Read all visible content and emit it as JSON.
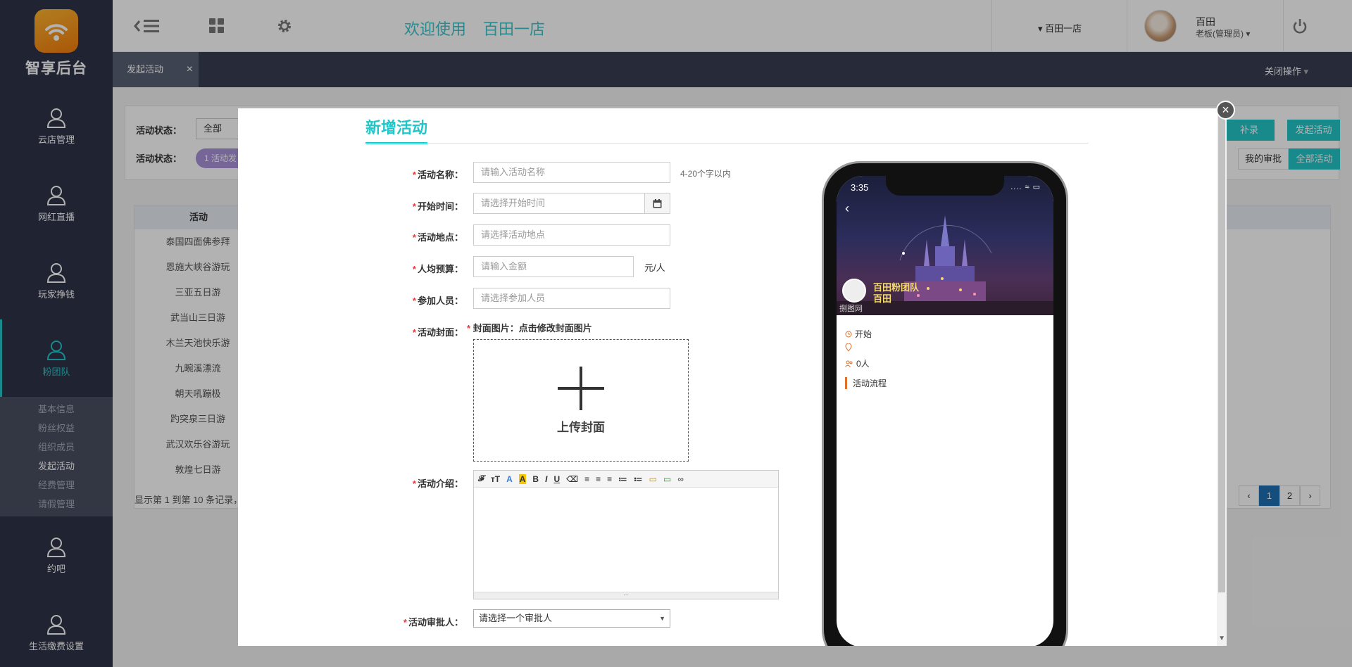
{
  "sidebar": {
    "logo_text": "智享后台",
    "items": [
      {
        "label": "云店管理"
      },
      {
        "label": "网红直播"
      },
      {
        "label": "玩家挣钱"
      },
      {
        "label": "粉团队"
      },
      {
        "label": "约吧"
      },
      {
        "label": "生活缴费设置"
      }
    ],
    "submenu": [
      "基本信息",
      "粉丝权益",
      "组织成员",
      "发起活动",
      "经费管理",
      "请假管理"
    ],
    "active_item": "粉团队",
    "active_submenu": "发起活动"
  },
  "topbar": {
    "welcome": "欢迎使用",
    "store_name": "百田一店",
    "store_select": "百田一店",
    "user_name": "百田",
    "user_role": "老板(管理员)",
    "icons": [
      "collapse-menu-icon",
      "grid-icon",
      "gear-icon",
      "power-icon"
    ]
  },
  "tabbar": {
    "tab_label": "发起活动",
    "close_label": "×",
    "close_ops": "关闭操作"
  },
  "background": {
    "filter_status_label": "活动状态：",
    "filter_status_value": "全部",
    "filter_status2_label": "活动状态：",
    "filter_pill": "1 活动发",
    "btn_record": "补录",
    "btn_launch": "发起活动",
    "btn_my_approval": "我的审批",
    "btn_all": "全部活动",
    "table_header": "活动",
    "rows": [
      "泰国四面佛参拜",
      "恩施大峡谷游玩",
      "三亚五日游",
      "武当山三日游",
      "木兰天池快乐游",
      "九畹溪漂流",
      "朝天吼蹦极",
      "趵突泉三日游",
      "武汉欢乐谷游玩",
      "敦煌七日游"
    ],
    "footer": "显示第 1 到第 10 条记录，",
    "pager": [
      "‹",
      "1",
      "2",
      "›"
    ]
  },
  "modal": {
    "title": "新增活动",
    "close": "×",
    "fields": {
      "name_label": "活动名称：",
      "name_placeholder": "请输入活动名称",
      "name_hint": "4-20个字以内",
      "start_label": "开始时间：",
      "start_placeholder": "请选择开始时间",
      "place_label": "活动地点：",
      "place_placeholder": "请选择活动地点",
      "budget_label": "人均预算：",
      "budget_placeholder": "请输入金额",
      "budget_unit": "元/人",
      "members_label": "参加人员：",
      "members_placeholder": "请选择参加人员",
      "cover_label": "活动封面：",
      "cover_note": "封面图片：点击修改封面图片",
      "cover_upload": "上传封面",
      "intro_label": "活动介绍：",
      "approver_label": "活动审批人：",
      "approver_value": "请选择一个审批人"
    },
    "required_mark": "*",
    "editor_toolbar": [
      "𝓕",
      "тT",
      "A",
      "A",
      "B",
      "I",
      "U",
      "⌫",
      "≡",
      "≡",
      "≡",
      "≔",
      "≔",
      "▭",
      "▭",
      "∞"
    ]
  },
  "phone": {
    "time": "3:35",
    "status": "....  ≈  ▭",
    "back": "‹",
    "team_name": "百田粉团队",
    "owner_name": "百田",
    "watermark": "捌图网",
    "start_text": "开始",
    "location_text": "",
    "people_text": "0人",
    "flow_text": "活动流程"
  },
  "colors": {
    "accent": "#23c6c8",
    "sidebar_bg": "#2e3347",
    "tabbar_bg": "#373d52",
    "required": "#e4393c"
  }
}
